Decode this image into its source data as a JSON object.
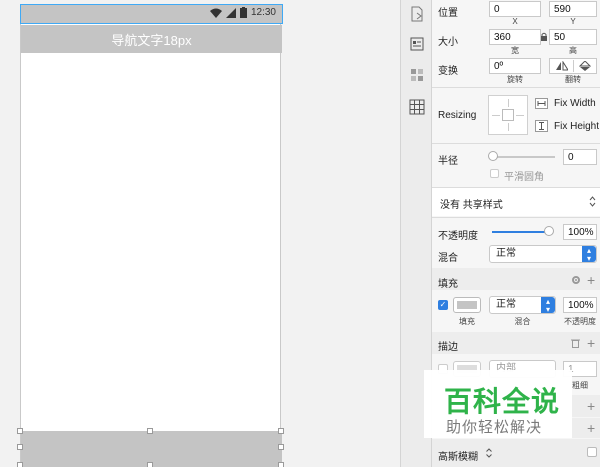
{
  "artboard": {
    "status_time": "12:30",
    "nav_title": "导航文字18px"
  },
  "inspector": {
    "position": {
      "label": "位置",
      "x": "0",
      "y": "590",
      "x_caption": "X",
      "y_caption": "Y"
    },
    "size": {
      "label": "大小",
      "width": "360",
      "height": "50",
      "width_caption": "宽",
      "height_caption": "高"
    },
    "transform": {
      "label": "变换",
      "rotation": "0º",
      "rotation_caption": "旋转",
      "flip_caption": "翻转"
    },
    "resizing": {
      "label": "Resizing",
      "fix_width": "Fix Width",
      "fix_height": "Fix Height"
    },
    "radius": {
      "label": "半径",
      "value": "0",
      "smooth_corners": "平滑圆角",
      "slider_value": 0
    },
    "shared_style": {
      "value": "没有 共享样式"
    },
    "opacity": {
      "label": "不透明度",
      "value": "100%",
      "slider_value": 1.0
    },
    "blending": {
      "label": "混合",
      "value": "正常"
    },
    "fills": {
      "label": "填充",
      "blend_value": "正常",
      "opacity_value": "100%",
      "caption_fill": "填充",
      "caption_blend": "混合",
      "caption_opacity": "不透明度",
      "enabled": true,
      "swatch_color": "#c4c4c4"
    },
    "borders": {
      "label": "描边",
      "position_value": "内部",
      "thickness_value": "1",
      "caption_thickness": "粗细"
    },
    "gaussian_blur": {
      "label": "高斯模糊"
    }
  },
  "watermark": {
    "title": "百科全说",
    "subtitle": "助你轻松解决"
  },
  "colors": {
    "accent": "#2f7fe0",
    "selection": "#3fa9f5",
    "placeholder_gray": "#c4c4c4"
  }
}
